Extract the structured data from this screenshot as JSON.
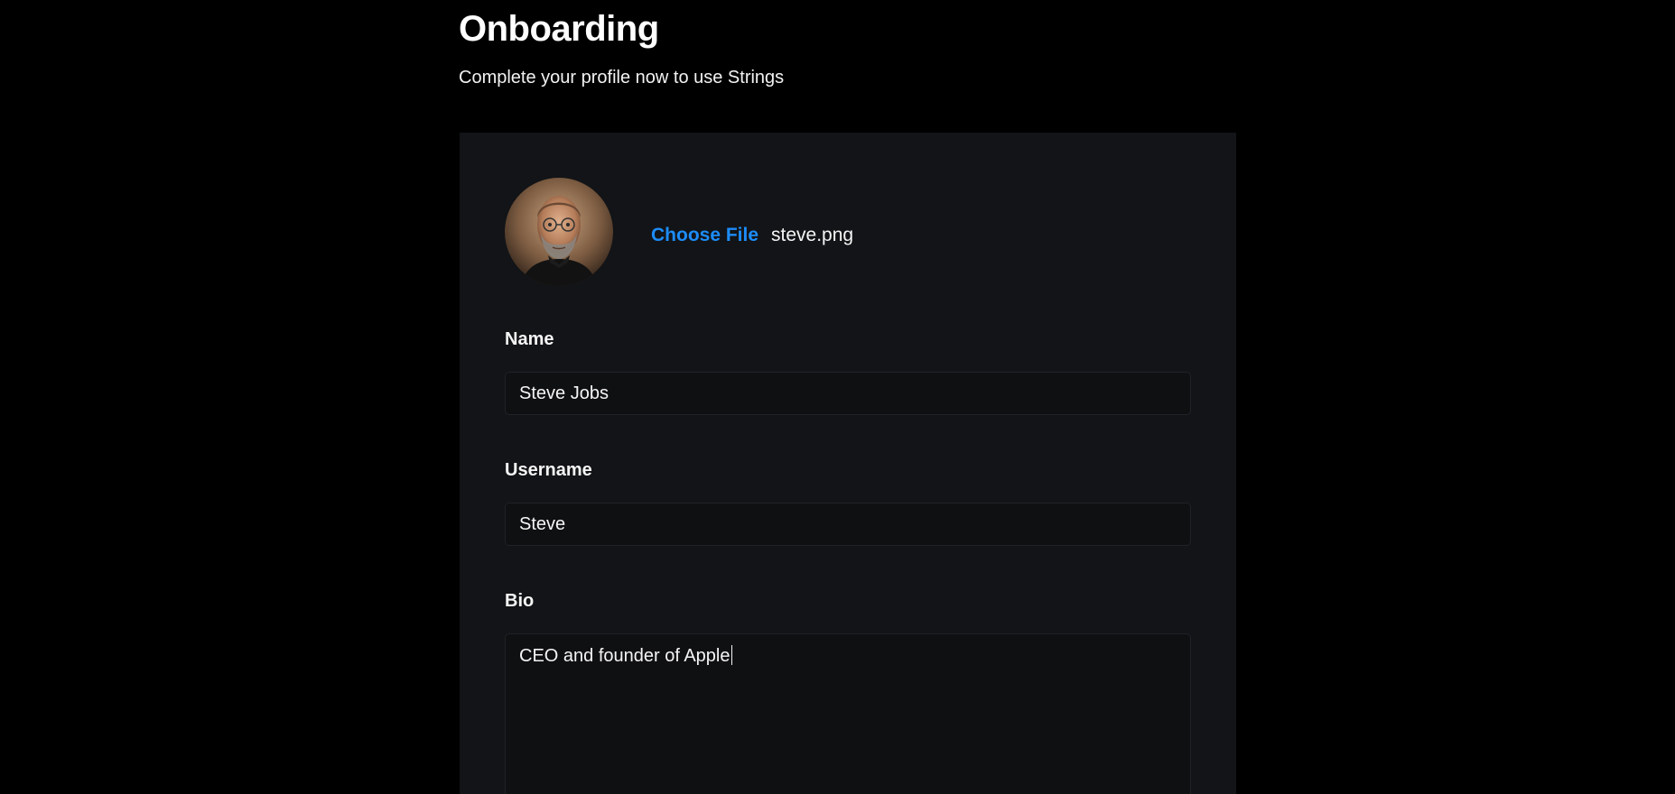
{
  "header": {
    "title": "Onboarding",
    "subtitle": "Complete your profile now to use Strings"
  },
  "profile_photo": {
    "button_label": "Choose File",
    "file_name": "steve.png"
  },
  "fields": {
    "name": {
      "label": "Name",
      "value": "Steve Jobs"
    },
    "username": {
      "label": "Username",
      "value": "Steve"
    },
    "bio": {
      "label": "Bio",
      "value": "CEO and founder of Apple"
    }
  },
  "colors": {
    "background": "#000000",
    "card": "#121417",
    "input": "#0f1012",
    "accent": "#1d8cf8",
    "text": "#ffffff"
  }
}
